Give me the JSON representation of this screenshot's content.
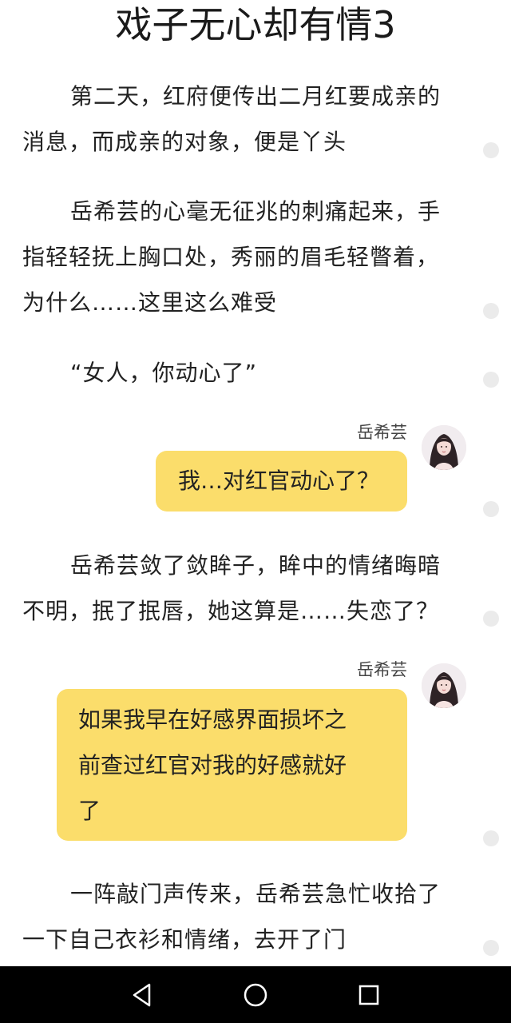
{
  "chapter_title": "戏子无心却有情3",
  "paragraphs": {
    "p1_line1": "第二天，红府便传出二月红要成亲的",
    "p1_line2": "消息，而成亲的对象，便是丫头",
    "p2_line1": "岳希芸的心毫无征兆的刺痛起来，手",
    "p2_line2": "指轻轻抚上胸口处，秀丽的眉毛轻瞥着，",
    "p2_line3": "为什么……这里这么难受",
    "p3_line1": "“女人，你动心了”",
    "p4_line1": "岳希芸敛了敛眸子，眸中的情绪晦暗",
    "p4_line2": "不明，抿了抿唇，她这算是……失恋了？",
    "p5_line1": "一阵敲门声传来，岳希芸急忙收拾了",
    "p5_line2": "一下自己衣衫和情绪，去开了门"
  },
  "chat": {
    "msg1": {
      "speaker": "岳希芸",
      "text": "我…对红官动心了？"
    },
    "msg2": {
      "speaker": "岳希芸",
      "line1": "如果我早在好感界面损坏之",
      "line2": "前查过红官对我的好感就好",
      "line3": "了"
    }
  },
  "icons": {
    "avatar": "character-avatar",
    "back": "triangle-back-icon",
    "home": "circle-home-icon",
    "recents": "square-recents-icon",
    "comment_marker": "comment-dot-icon"
  },
  "colors": {
    "bubble": "#fbdd6b",
    "navbar": "#000000",
    "dot": "#ebebeb"
  }
}
